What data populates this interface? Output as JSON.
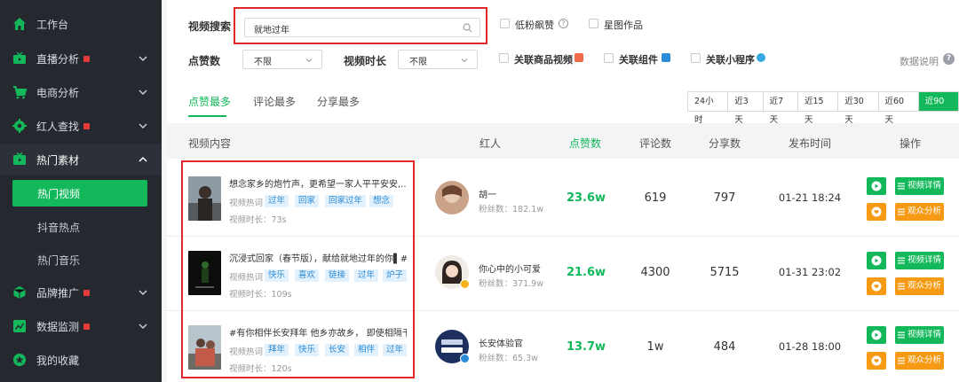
{
  "sidebar": {
    "items": [
      {
        "label": "工作台",
        "icon": "home-icon"
      },
      {
        "label": "直播分析",
        "icon": "tv-icon",
        "flag": true
      },
      {
        "label": "电商分析",
        "icon": "cart-icon"
      },
      {
        "label": "红人查找",
        "icon": "gear-icon",
        "flag": true
      },
      {
        "label": "热门素材",
        "icon": "monitor-icon"
      },
      {
        "label": "品牌推广",
        "icon": "cube-icon",
        "flag": true
      },
      {
        "label": "数据监测",
        "icon": "chart-icon",
        "flag": true
      },
      {
        "label": "我的收藏",
        "icon": "star-icon"
      }
    ],
    "sub_items": [
      "热门视频",
      "抖音热点",
      "热门音乐"
    ]
  },
  "filters": {
    "search_label": "视频搜索",
    "search_value": "就地过年",
    "low_fans_label": "低粉飙赞",
    "star_work_label": "星图作品",
    "likes_label": "点赞数",
    "likes_value": "不限",
    "duration_label": "视频时长",
    "duration_value": "不限",
    "goods_video_label": "关联商品视频",
    "component_label": "关联组件",
    "mini_program_label": "关联小程序",
    "data_explain": "数据说明",
    "info_symbol": "?"
  },
  "tabs": [
    "点赞最多",
    "评论最多",
    "分享最多"
  ],
  "ranges": [
    "24小时",
    "近3天",
    "近7天",
    "近15天",
    "近30天",
    "近60天",
    "近90天"
  ],
  "table": {
    "headers": [
      "视频内容",
      "红人",
      "点赞数",
      "评论数",
      "分享数",
      "发布时间",
      "操作"
    ],
    "rows": [
      {
        "title": "想念家乡的炮竹声，更希望一家人平平安安,...",
        "tags_label": "视频热词",
        "tags": [
          "过年",
          "回家",
          "回家过年",
          "想念"
        ],
        "duration_label": "视频时长：",
        "duration": "73s",
        "kol": "胡一",
        "fans_label": "粉丝数：",
        "fans": "182.1w",
        "likes": "23.6w",
        "comments": "619",
        "shares": "797",
        "time": "01-21 18:24"
      },
      {
        "title": "沉浸式回家（春节版），献给就地过年的你▌#...",
        "tags_label": "视频热词",
        "tags": [
          "快乐",
          "喜欢",
          "链接",
          "过年",
          "炉子"
        ],
        "duration_label": "视频时长：",
        "duration": "109s",
        "kol": "你心中的小可爱",
        "fans_label": "粉丝数：",
        "fans": "371.9w",
        "likes": "21.6w",
        "comments": "4300",
        "shares": "5715",
        "time": "01-31 23:02"
      },
      {
        "title": "#有你相伴长安拜年 他乡亦故乡， 即使相隔千...",
        "tags_label": "视频热词",
        "tags": [
          "拜年",
          "快乐",
          "长安",
          "相伴",
          "过年"
        ],
        "duration_label": "视频时长：",
        "duration": "120s",
        "kol": "长安体验官",
        "fans_label": "粉丝数：",
        "fans": "65.3w",
        "likes": "13.7w",
        "comments": "1w",
        "shares": "484",
        "time": "01-28 18:00"
      }
    ],
    "detail_btn": "视频详情",
    "audience_btn": "观众分析"
  },
  "colors": {
    "accent": "#12b85a",
    "orange": "#f59a12",
    "sidebar_bg": "#25282f",
    "highlight_red": "#e0282a"
  }
}
